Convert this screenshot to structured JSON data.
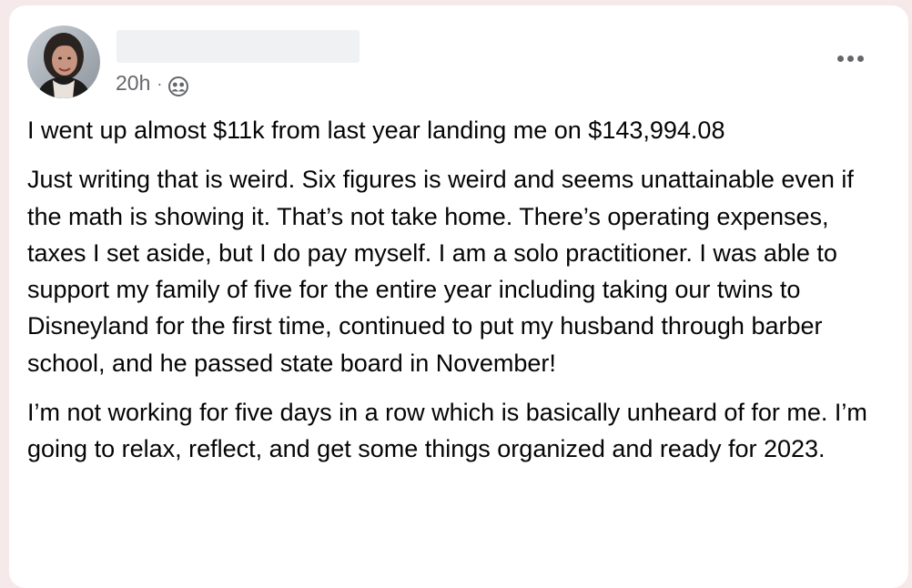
{
  "post": {
    "timestamp": "20h",
    "separator": "·",
    "audience_icon": "friends-icon",
    "more_icon": "more-options-icon",
    "paragraphs": [
      "I went up almost $11k from last year landing me on $143,994.08",
      "Just writing that is weird. Six figures is weird and seems unattainable even if the math is showing it. That’s not take home. There’s operating expenses, taxes I set aside, but I do pay myself. I am a solo practitioner. I was able to support my family of five for the entire year including taking our twins to Disneyland for the first time, continued to put my husband through  barber school, and he passed state board in November!",
      "I’m not working for five days in a row which is basically unheard of for me. I’m going to relax, reflect, and get some things organized and ready for 2023."
    ]
  }
}
